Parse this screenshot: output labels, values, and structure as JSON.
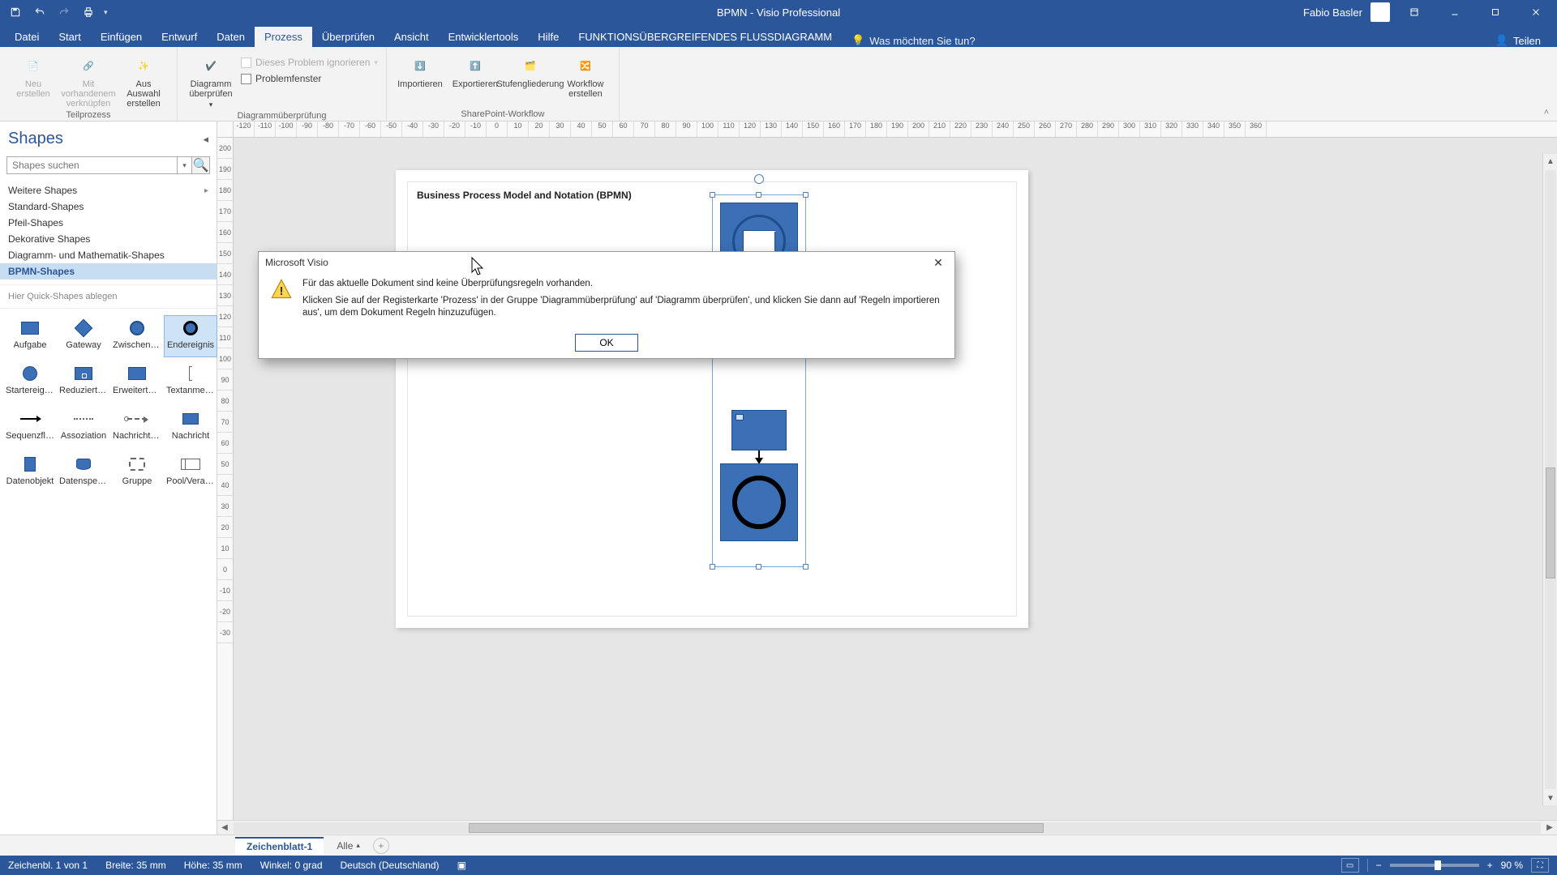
{
  "app": {
    "title": "BPMN  -  Visio Professional",
    "user": "Fabio Basler"
  },
  "tabs": {
    "file": "Datei",
    "home": "Start",
    "insert": "Einfügen",
    "design": "Entwurf",
    "data": "Daten",
    "process": "Prozess",
    "review": "Überprüfen",
    "view": "Ansicht",
    "dev": "Entwicklertools",
    "help": "Hilfe",
    "addin": "FUNKTIONSÜBERGREIFENDES FLUSSDIAGRAMM",
    "tellme": "Was möchten Sie tun?",
    "share": "Teilen"
  },
  "ribbon": {
    "groups": {
      "teilprozess": {
        "label": "Teilprozess",
        "new": "Neu erstellen",
        "link": "Mit vorhandenem verknüpfen",
        "fromsel": "Aus Auswahl erstellen"
      },
      "validate": {
        "label": "Diagrammüberprüfung",
        "check": "Diagramm überprüfen",
        "ignore": "Dieses Problem ignorieren",
        "window": "Problemfenster"
      },
      "sharepoint": {
        "label": "SharePoint-Workflow",
        "import": "Importieren",
        "export": "Exportieren",
        "stage": "Stufengliederung",
        "create": "Workflow erstellen"
      }
    }
  },
  "shapes": {
    "title": "Shapes",
    "search_placeholder": "Shapes suchen",
    "stencils": {
      "more": "Weitere Shapes",
      "standard": "Standard-Shapes",
      "arrow": "Pfeil-Shapes",
      "deco": "Dekorative Shapes",
      "math": "Diagramm- und Mathematik-Shapes",
      "bpmn": "BPMN-Shapes"
    },
    "quickdrop": "Hier Quick-Shapes ablegen",
    "items": {
      "aufgabe": "Aufgabe",
      "gateway": "Gateway",
      "zwischen": "Zwischener...",
      "end": "Endereignis",
      "start": "Startereignis",
      "redtp": "Reduzierter Teilprozess",
      "erwtp": "Erweiterter Teilprozess",
      "txt": "Textanmerk...",
      "seq": "Sequenzfluss",
      "assoz": "Assoziation",
      "nachrfluss": "Nachrichten...",
      "nachricht": "Nachricht",
      "dobj": "Datenobjekt",
      "dspeich": "Datenspeich...",
      "gruppe": "Gruppe",
      "pool": "Pool/Verant..."
    }
  },
  "page": {
    "doc_heading": "Business Process Model and Notation (BPMN)",
    "tab": "Zeichenblatt-1",
    "all": "Alle"
  },
  "ruler_h": [
    "-120",
    "-110",
    "-100",
    "-90",
    "-80",
    "-70",
    "-60",
    "-50",
    "-40",
    "-30",
    "-20",
    "-10",
    "0",
    "10",
    "20",
    "30",
    "40",
    "50",
    "60",
    "70",
    "80",
    "90",
    "100",
    "110",
    "120",
    "130",
    "140",
    "150",
    "160",
    "170",
    "180",
    "190",
    "200",
    "210",
    "220",
    "230",
    "240",
    "250",
    "260",
    "270",
    "280",
    "290",
    "300",
    "310",
    "320",
    "330",
    "340",
    "350",
    "360"
  ],
  "ruler_v": [
    "200",
    "190",
    "180",
    "170",
    "160",
    "150",
    "140",
    "130",
    "120",
    "110",
    "100",
    "90",
    "80",
    "70",
    "60",
    "50",
    "40",
    "30",
    "20",
    "10",
    "0",
    "-10",
    "-20",
    "-30"
  ],
  "dialog": {
    "title": "Microsoft Visio",
    "line1": "Für das aktuelle Dokument sind keine Überprüfungsregeln vorhanden.",
    "line2": "Klicken Sie auf der Registerkarte 'Prozess' in der Gruppe 'Diagrammüberprüfung' auf 'Diagramm überprüfen', und klicken Sie dann auf 'Regeln importieren aus', um dem Dokument Regeln hinzuzufügen.",
    "ok": "OK"
  },
  "status": {
    "sel": "Zeichenbl. 1 von 1",
    "w": "Breite: 35 mm",
    "h": "Höhe: 35 mm",
    "ang": "Winkel: 0 grad",
    "lang": "Deutsch (Deutschland)",
    "zoom": "90 %"
  }
}
